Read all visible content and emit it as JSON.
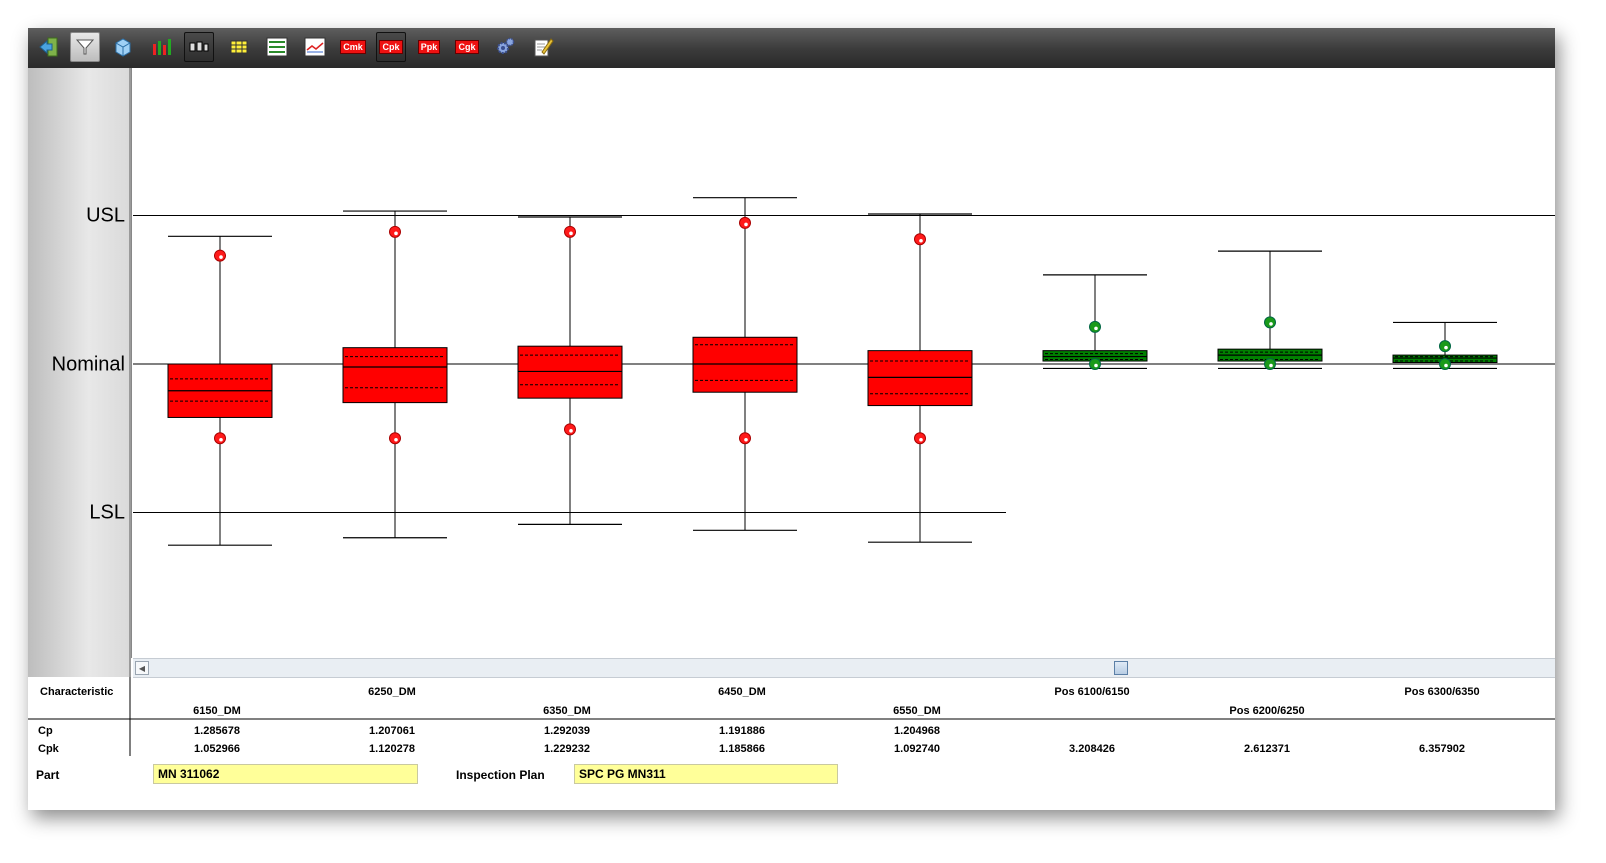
{
  "toolbar": {
    "icons": [
      "exit-icon",
      "filter-icon",
      "cube-icon",
      "bar-chart-icon",
      "boxplot-icon",
      "table-icon",
      "list-icon",
      "trend-icon",
      "cmk-icon",
      "cpk-icon",
      "ppk-icon",
      "cgk-icon",
      "gear-icon",
      "edit-icon"
    ],
    "cmk_label": "Cmk",
    "cpk_label": "Cpk",
    "ppk_label": "Ppk",
    "cgk_label": "Cgk"
  },
  "chart_data": {
    "type": "boxplot",
    "reference_lines": [
      "USL",
      "Nominal",
      "LSL"
    ],
    "reference_values": {
      "USL": 1,
      "Nominal": 0,
      "LSL": -1
    },
    "ylim": [
      -1.98,
      2.0
    ],
    "colors": {
      "out_of_spec": "#ff0000",
      "in_spec": "#008000"
    },
    "series": [
      {
        "name": "6150_DM",
        "color": "red",
        "whisker_low": -1.22,
        "q1": -0.36,
        "q3": 0.0,
        "whisker_high": 0.86,
        "median": -0.18,
        "inner_low": -0.25,
        "inner_high": -0.1,
        "dot_high": 0.73,
        "dot_low": -0.5
      },
      {
        "name": "6250_DM",
        "color": "red",
        "whisker_low": -1.17,
        "q1": -0.26,
        "q3": 0.11,
        "whisker_high": 1.03,
        "median": -0.02,
        "inner_low": -0.16,
        "inner_high": 0.05,
        "dot_high": 0.89,
        "dot_low": -0.5
      },
      {
        "name": "6350_DM",
        "color": "red",
        "whisker_low": -1.08,
        "q1": -0.23,
        "q3": 0.12,
        "whisker_high": 0.99,
        "median": -0.05,
        "inner_low": -0.14,
        "inner_high": 0.06,
        "dot_high": 0.89,
        "dot_low": -0.44
      },
      {
        "name": "6450_DM",
        "color": "red",
        "whisker_low": -1.12,
        "q1": -0.19,
        "q3": 0.18,
        "whisker_high": 1.12,
        "median": 0.0,
        "inner_low": -0.11,
        "inner_high": 0.13,
        "dot_high": 0.95,
        "dot_low": -0.5
      },
      {
        "name": "6550_DM",
        "color": "red",
        "whisker_low": -1.2,
        "q1": -0.28,
        "q3": 0.09,
        "whisker_high": 1.01,
        "median": -0.09,
        "inner_low": -0.2,
        "inner_high": 0.02,
        "dot_high": 0.84,
        "dot_low": -0.5
      },
      {
        "name": "Pos 6100/6150",
        "color": "green",
        "whisker_low": -0.03,
        "q1": 0.02,
        "q3": 0.09,
        "whisker_high": 0.6,
        "median": 0.05,
        "inner_low": 0.03,
        "inner_high": 0.07,
        "dot_high": 0.25,
        "dot_low": 0.0
      },
      {
        "name": "Pos 6200/6250",
        "color": "green",
        "whisker_low": -0.03,
        "q1": 0.02,
        "q3": 0.1,
        "whisker_high": 0.76,
        "median": 0.06,
        "inner_low": 0.03,
        "inner_high": 0.08,
        "dot_high": 0.28,
        "dot_low": 0.0
      },
      {
        "name": "Pos 6300/6350",
        "color": "green",
        "whisker_low": -0.03,
        "q1": 0.01,
        "q3": 0.06,
        "whisker_high": 0.28,
        "median": 0.04,
        "inner_low": 0.02,
        "inner_high": 0.05,
        "dot_high": 0.12,
        "dot_low": 0.0
      }
    ]
  },
  "table": {
    "characteristic_label": "Characteristic",
    "cp_label": "Cp",
    "cpk_label": "Cpk",
    "columns": [
      {
        "name": "6150_DM",
        "cp": "1.285678",
        "cpk": "1.052966"
      },
      {
        "name": "6250_DM",
        "cp": "1.207061",
        "cpk": "1.120278"
      },
      {
        "name": "6350_DM",
        "cp": "1.292039",
        "cpk": "1.229232"
      },
      {
        "name": "6450_DM",
        "cp": "1.191886",
        "cpk": "1.185866"
      },
      {
        "name": "6550_DM",
        "cp": "1.204968",
        "cpk": "1.092740"
      },
      {
        "name": "Pos 6100/6150",
        "cp": "",
        "cpk": "3.208426"
      },
      {
        "name": "Pos 6200/6250",
        "cp": "",
        "cpk": "2.612371"
      },
      {
        "name": "Pos 6300/6350",
        "cp": "",
        "cpk": "6.357902"
      }
    ]
  },
  "footer": {
    "part_label": "Part",
    "part_value": "MN 311062",
    "plan_label": "Inspection Plan",
    "plan_value": "SPC PG MN311"
  }
}
